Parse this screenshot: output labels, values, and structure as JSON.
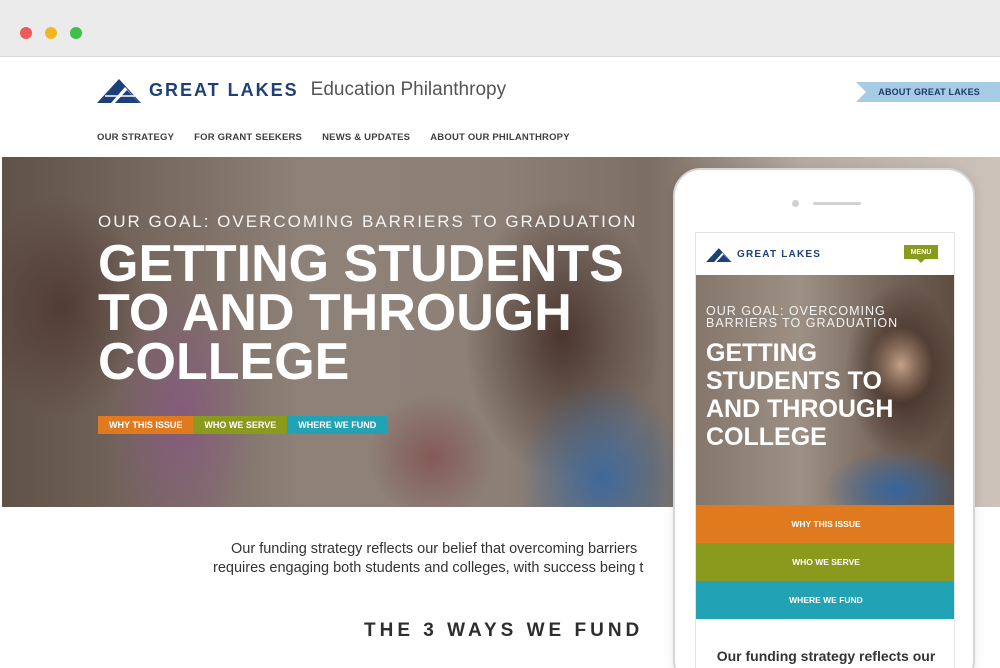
{
  "window": {
    "controls": [
      "close",
      "minimize",
      "maximize"
    ]
  },
  "header": {
    "logo_word": "GREAT LAKES",
    "logo_sub": "Education Philanthropy",
    "about_button": "ABOUT GREAT LAKES",
    "nav": [
      "OUR STRATEGY",
      "FOR GRANT SEEKERS",
      "NEWS & UPDATES",
      "ABOUT OUR PHILANTHROPY"
    ]
  },
  "hero": {
    "eyebrow": "OUR GOAL: OVERCOMING BARRIERS TO GRADUATION",
    "title": "GETTING STUDENTS TO AND THROUGH COLLEGE",
    "buttons": [
      "WHY THIS ISSUE",
      "WHO WE SERVE",
      "WHERE WE FUND"
    ]
  },
  "body": {
    "intro_line1": "Our funding strategy reflects our belief that overcoming barriers",
    "intro_line2": "requires engaging both students and colleges, with success being t",
    "section_heading": "THE 3 WAYS WE FUND"
  },
  "mobile": {
    "logo_word": "GREAT LAKES",
    "menu_label": "MENU",
    "eyebrow": "OUR GOAL: OVERCOMING BARRIERS TO GRADUATION",
    "title": "GETTING STUDENTS TO AND THROUGH COLLEGE",
    "buttons": [
      "WHY THIS ISSUE",
      "WHO WE SERVE",
      "WHERE WE FUND"
    ],
    "intro": "Our funding strategy reflects our"
  },
  "colors": {
    "brand_blue": "#1f3f78",
    "orange": "#e07a1f",
    "olive": "#8a9a1d",
    "teal": "#21a2b5",
    "about_bg": "#a6cbe4"
  }
}
